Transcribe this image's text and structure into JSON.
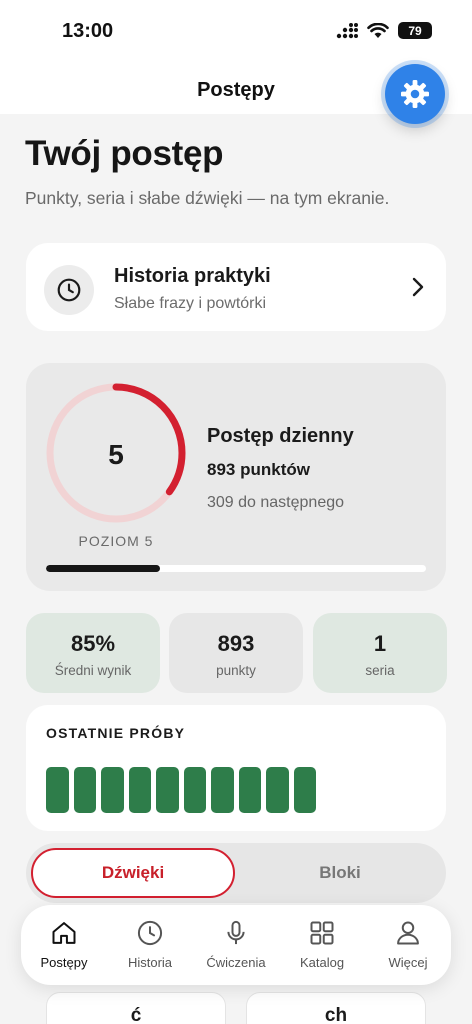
{
  "status_bar": {
    "time": "13:00",
    "battery": "79"
  },
  "nav": {
    "title": "Postępy",
    "settings_icon": "gear-icon"
  },
  "header": {
    "title": "Twój postęp",
    "subtitle": "Punkty, seria i słabe dźwięki — na tym ekranie."
  },
  "history_card": {
    "icon": "clock-icon",
    "title": "Historia praktyki",
    "subtitle": "Słabe frazy i powtórki",
    "chevron": "chevron-right-icon"
  },
  "daily_progress": {
    "level": "5",
    "level_label": "POZIOM 5",
    "ring_fraction": 0.35,
    "title": "Postęp dzienny",
    "points": "893 punktów",
    "to_next": "309 do następnego",
    "bar_fraction": 0.3
  },
  "stats": [
    {
      "value": "85%",
      "label": "Średni wynik"
    },
    {
      "value": "893",
      "label": "punkty"
    },
    {
      "value": "1",
      "label": "seria"
    }
  ],
  "recent_attempts": {
    "title": "OSTATNIE PRÓBY",
    "count": 10,
    "color": "#2e7d4a"
  },
  "segmented_control": {
    "active_label": "Dźwięki",
    "inactive_label": "Bloki"
  },
  "sound_cards": [
    "ć",
    "ch"
  ],
  "tabbar": [
    {
      "label": "Postępy",
      "icon": "home-icon",
      "active": true
    },
    {
      "label": "Historia",
      "icon": "clock-icon",
      "active": false
    },
    {
      "label": "Ćwiczenia",
      "icon": "microphone-icon",
      "active": false
    },
    {
      "label": "Katalog",
      "icon": "grid-icon",
      "active": false
    },
    {
      "label": "Więcej",
      "icon": "user-icon",
      "active": false
    }
  ],
  "colors": {
    "accent_red": "#d32030",
    "settings_blue": "#2f82e8",
    "success_green": "#2e7d4a",
    "stat_green_bg": "#dfe8e1",
    "stat_gray_bg": "#e7e7e7"
  }
}
